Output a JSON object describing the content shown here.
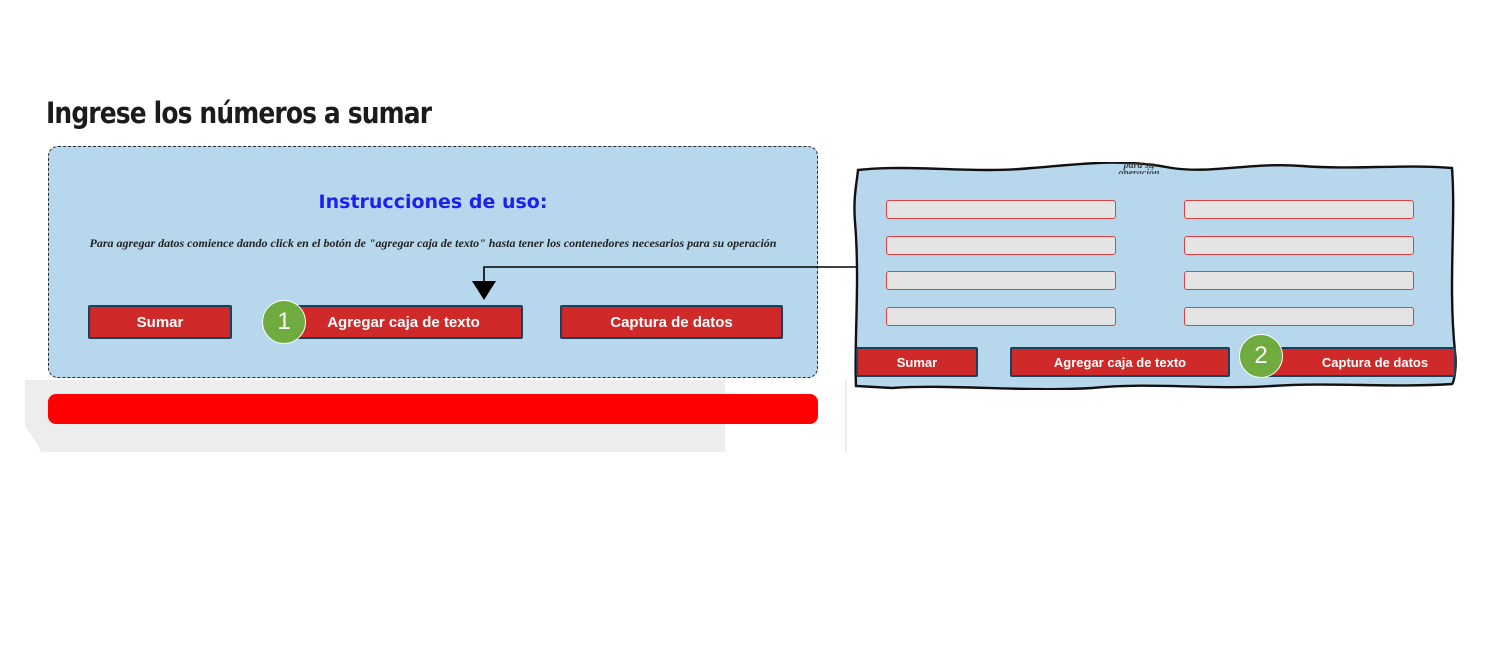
{
  "page": {
    "title": "Ingrese los números a sumar"
  },
  "instructions": {
    "heading": "Instrucciones de uso:",
    "text": "Para agregar datos comience dando click en el botón de \"agregar caja de texto\" hasta tener los contenedores necesarios para su operación"
  },
  "buttons": {
    "sumar": "Sumar",
    "agregar": "Agregar caja de texto",
    "captura": "Captura de datos"
  },
  "steps": {
    "step1": "1",
    "step2": "2"
  },
  "snippet": {
    "cut_text": "para su operación",
    "inputs": [
      "",
      "",
      "",
      "",
      "",
      "",
      "",
      ""
    ],
    "buttons": {
      "sumar": "Sumar",
      "agregar": "Agregar caja de texto",
      "captura": "Captura de datos"
    }
  },
  "colors": {
    "panel": "#b6d7ec",
    "button": "#d0292a",
    "bar": "#ff0000",
    "badge": "#6fab3e",
    "heading": "#1f1ff0"
  }
}
